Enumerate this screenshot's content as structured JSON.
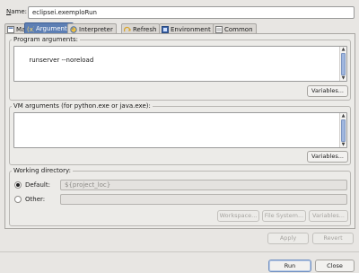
{
  "name_row": {
    "label": "Name:",
    "value": "eclipsei.exemploRun"
  },
  "tabs": [
    {
      "label": "Main",
      "icon": "main-tab-icon"
    },
    {
      "label": "Arguments",
      "icon": "arguments-tab-icon"
    },
    {
      "label": "Interpreter",
      "icon": "interpreter-tab-icon"
    },
    {
      "label": "Refresh",
      "icon": "refresh-tab-icon"
    },
    {
      "label": "Environment",
      "icon": "environment-tab-icon"
    },
    {
      "label": "Common",
      "icon": "common-tab-icon"
    }
  ],
  "program_args": {
    "title": "Program arguments:",
    "value": "runserver --noreload",
    "variables_button": "Variables..."
  },
  "vm_args": {
    "title": "VM arguments (for python.exe or java.exe):",
    "value": "",
    "variables_button": "Variables..."
  },
  "working_dir": {
    "title": "Working directory:",
    "default_label": "Default:",
    "default_value": "${project_loc}",
    "other_label": "Other:",
    "other_value": "",
    "selected": "default",
    "workspace_button": "Workspace...",
    "filesystem_button": "File System...",
    "variables_button": "Variables..."
  },
  "apply_button": "Apply",
  "revert_button": "Revert",
  "run_button": "Run",
  "close_button": "Close",
  "colors": {
    "active_tab": "#5d7fb4",
    "scroll_thumb": "#9fb6de",
    "background": "#e8e6e3"
  }
}
